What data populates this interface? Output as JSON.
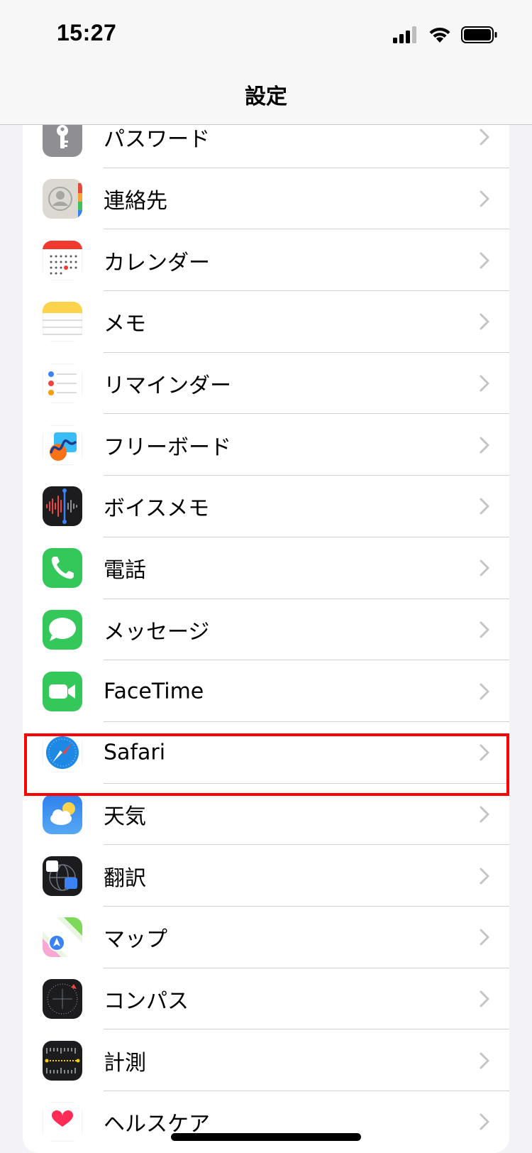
{
  "status_bar": {
    "time": "15:27",
    "icons": [
      "signal-icon",
      "wifi-icon",
      "battery-icon"
    ]
  },
  "nav": {
    "title": "設定"
  },
  "rows": [
    {
      "label": "パスワード",
      "icon": "key-icon"
    },
    {
      "label": "連絡先",
      "icon": "contacts-icon"
    },
    {
      "label": "カレンダー",
      "icon": "calendar-icon"
    },
    {
      "label": "メモ",
      "icon": "notes-icon"
    },
    {
      "label": "リマインダー",
      "icon": "reminders-icon"
    },
    {
      "label": "フリーボード",
      "icon": "freeform-icon"
    },
    {
      "label": "ボイスメモ",
      "icon": "voice-memo-icon"
    },
    {
      "label": "電話",
      "icon": "phone-icon"
    },
    {
      "label": "メッセージ",
      "icon": "messages-icon"
    },
    {
      "label": "FaceTime",
      "icon": "facetime-icon"
    },
    {
      "label": "Safari",
      "icon": "safari-icon"
    },
    {
      "label": "天気",
      "icon": "weather-icon"
    },
    {
      "label": "翻訳",
      "icon": "translate-icon"
    },
    {
      "label": "マップ",
      "icon": "maps-icon"
    },
    {
      "label": "コンパス",
      "icon": "compass-icon"
    },
    {
      "label": "計測",
      "icon": "measure-icon"
    },
    {
      "label": "ヘルスケア",
      "icon": "health-icon"
    }
  ],
  "highlighted_row": "Safari",
  "colors": {
    "highlight": "#ff0000",
    "background": "#f2f2f7"
  }
}
